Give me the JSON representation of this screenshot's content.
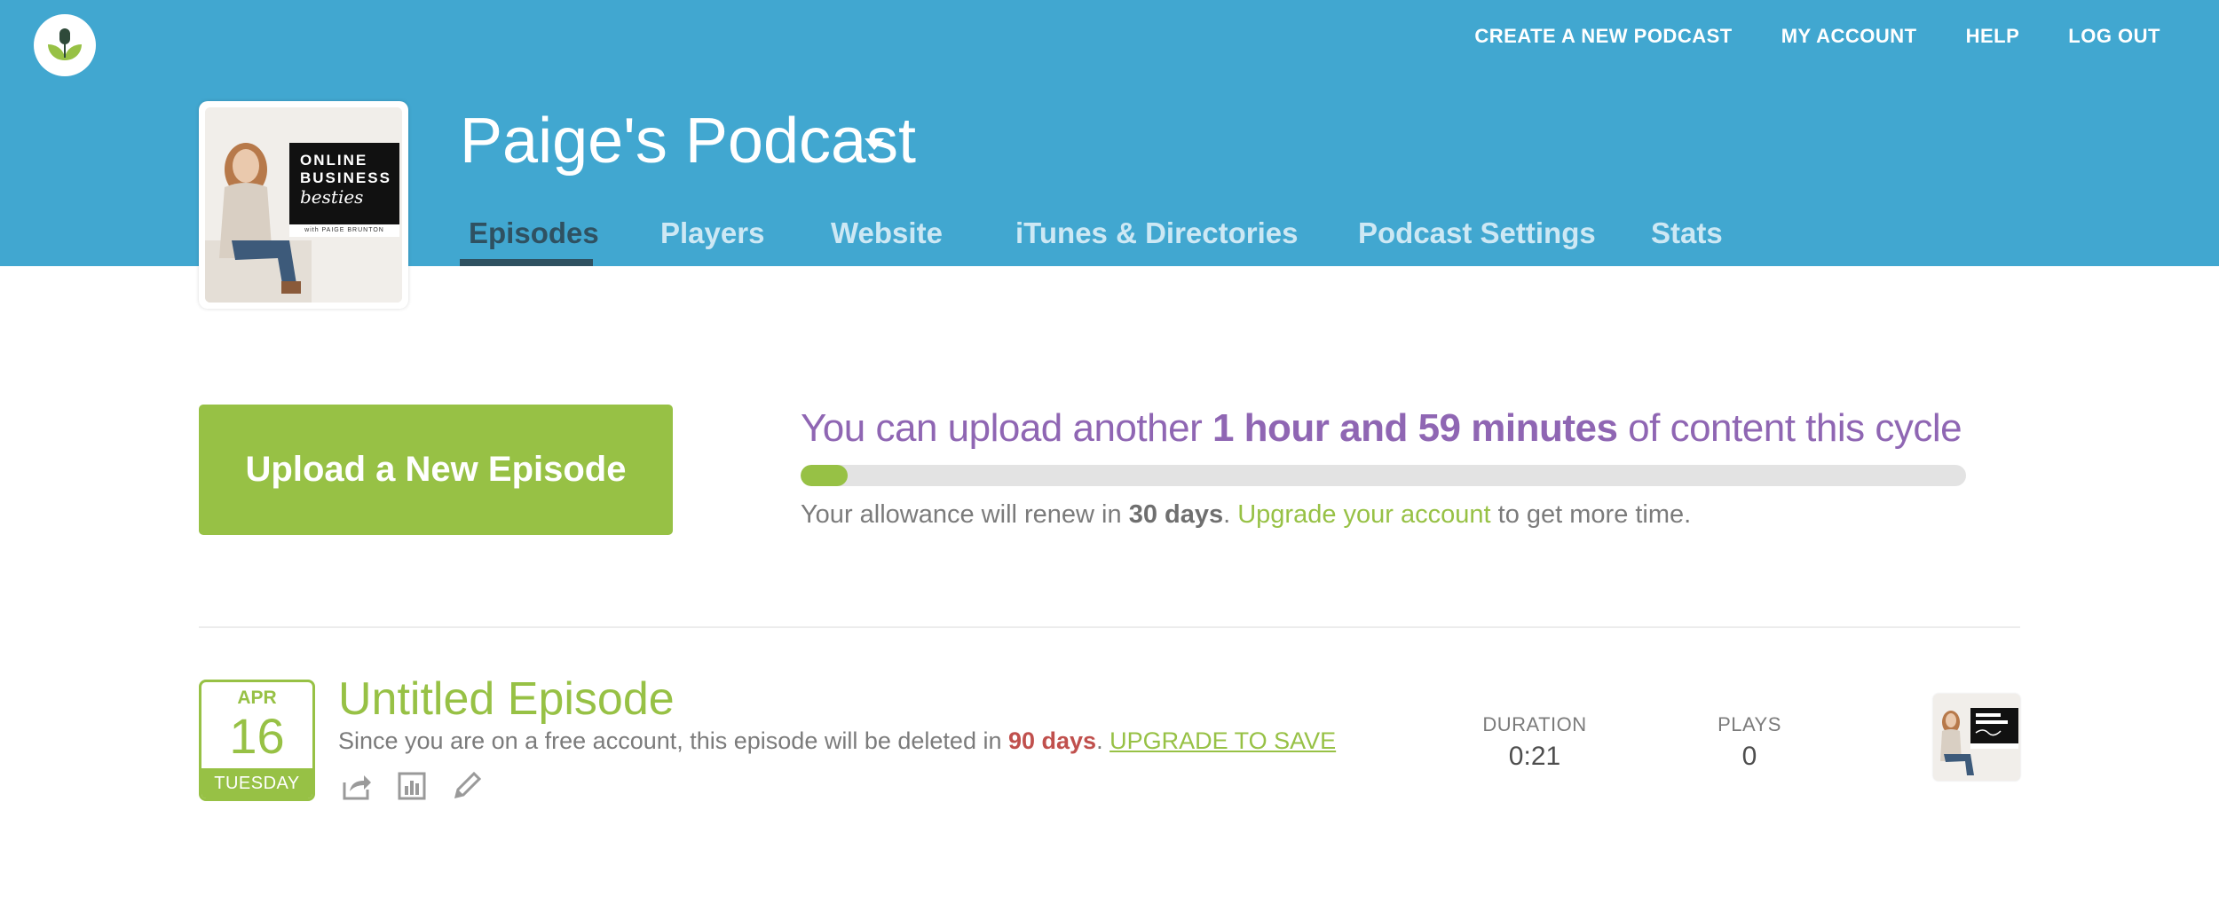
{
  "header": {
    "nav": [
      {
        "label": "CREATE A NEW PODCAST"
      },
      {
        "label": "MY ACCOUNT"
      },
      {
        "label": "HELP"
      },
      {
        "label": "LOG OUT"
      }
    ],
    "podcast_title": "Paige's Podcast",
    "cover": {
      "lines": [
        "ONLINE",
        "BUSINESS"
      ],
      "script": "besties",
      "byline": "with PAIGE BRUNTON"
    },
    "tabs": [
      {
        "label": "Episodes",
        "active": true
      },
      {
        "label": "Players"
      },
      {
        "label": "Website"
      },
      {
        "label": "iTunes & Directories"
      },
      {
        "label": "Podcast Settings"
      },
      {
        "label": "Stats"
      }
    ],
    "bg_color": "#41a7d0"
  },
  "upload": {
    "button_label": "Upload a New Episode",
    "headline_prefix": "You can upload another ",
    "headline_amount": "1 hour and 59 minutes",
    "headline_suffix": " of content this cycle",
    "progress_fraction": 0.04,
    "renew_prefix": "Your allowance will renew in ",
    "renew_days": "30 days",
    "renew_period": ". ",
    "upgrade_link": "Upgrade your account",
    "renew_suffix": " to get more time."
  },
  "episode": {
    "month": "APR",
    "day": "16",
    "weekday": "TUESDAY",
    "title": "Untitled Episode",
    "note_prefix": "Since you are on a free account, this episode will be deleted in ",
    "note_days": "90 days",
    "note_period": ". ",
    "upgrade_link": "UPGRADE TO SAVE",
    "actions": [
      "share-icon",
      "stats-icon",
      "edit-icon"
    ],
    "duration_label": "DURATION",
    "duration_value": "0:21",
    "plays_label": "PLAYS",
    "plays_value": "0"
  },
  "colors": {
    "accent_green": "#97c145",
    "accent_purple": "#8f66b3",
    "warning_red": "#c0504d",
    "nav_dark": "#2f5161"
  }
}
